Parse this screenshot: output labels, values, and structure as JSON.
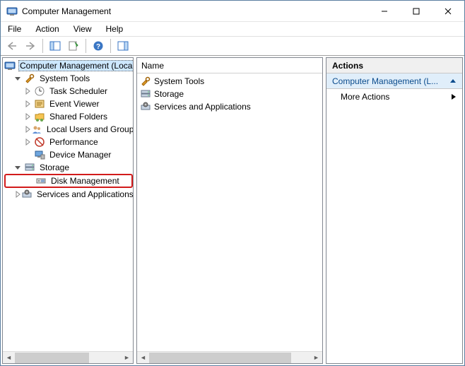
{
  "window": {
    "title": "Computer Management"
  },
  "menu": {
    "file": "File",
    "action": "Action",
    "view": "View",
    "help": "Help"
  },
  "tree": {
    "root": "Computer Management (Local",
    "system_tools": "System Tools",
    "task_scheduler": "Task Scheduler",
    "event_viewer": "Event Viewer",
    "shared_folders": "Shared Folders",
    "local_users": "Local Users and Groups",
    "performance": "Performance",
    "device_manager": "Device Manager",
    "storage": "Storage",
    "disk_management": "Disk Management",
    "services_apps": "Services and Applications"
  },
  "list": {
    "header_name": "Name",
    "items": {
      "system_tools": "System Tools",
      "storage": "Storage",
      "services_apps": "Services and Applications"
    }
  },
  "actions": {
    "header": "Actions",
    "group": "Computer Management (L...",
    "more": "More Actions"
  }
}
